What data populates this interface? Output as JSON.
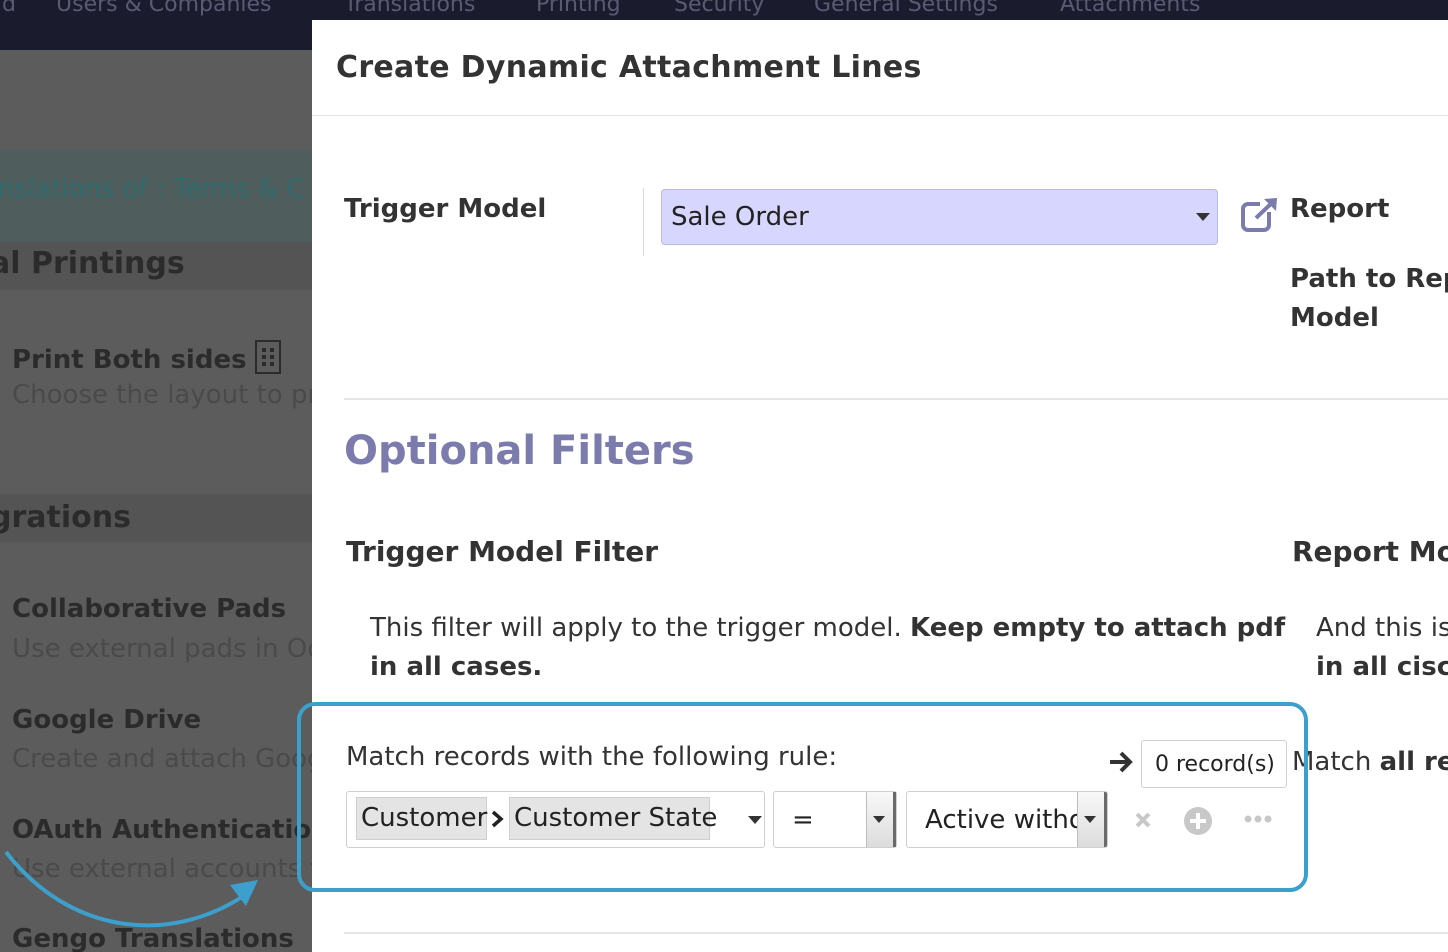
{
  "background": {
    "topbar_items": [
      "d",
      "Users & Companies",
      "Translations",
      "Printing",
      "Security",
      "General Settings",
      "Attachments"
    ],
    "breadcrumb_prefix": "anslations of : ",
    "breadcrumb_link": "Terms & C",
    "sections": [
      {
        "title": "al Printings"
      },
      {
        "title": "grations"
      }
    ],
    "settings": [
      {
        "title": "Print Both sides",
        "desc": "Choose the layout to pr"
      },
      {
        "title": "Collaborative Pads",
        "desc": "Use external pads in Od"
      },
      {
        "title": "Google Drive",
        "desc": "Create and attach Goog"
      },
      {
        "title": "OAuth Authentication",
        "desc": "Use external accounts t"
      },
      {
        "title": "Gengo Translations",
        "desc": ""
      }
    ]
  },
  "modal": {
    "title": "Create Dynamic Attachment Lines",
    "trigger_model_label": "Trigger Model",
    "trigger_model_value": "Sale Order",
    "report_label": "Report",
    "path_label_line1": "Path to Repo",
    "path_label_line2": "Model",
    "optional_filters_heading": "Optional Filters",
    "trigger_filter": {
      "title": "Trigger Model Filter",
      "help_line1_plain": "This filter will apply to the trigger model. ",
      "help_line1_bold": "Keep empty to attach pdf",
      "help_line2_bold": "in all cases."
    },
    "report_filter": {
      "title": "Report Mod",
      "help_line1": "And this is",
      "help_line2_bold": "in all cisc",
      "match_prefix": "Match ",
      "match_bold": "all rec"
    },
    "domain": {
      "match_text": "Match records with the following rule:",
      "record_count": "0 record(s)",
      "path_segments": [
        "Customer",
        "Customer State"
      ],
      "operator": "=",
      "value": "Active witho"
    }
  },
  "colors": {
    "accent": "#7c7bad",
    "select_bg": "#d6d6ff",
    "highlight": "#3d9fcc"
  }
}
